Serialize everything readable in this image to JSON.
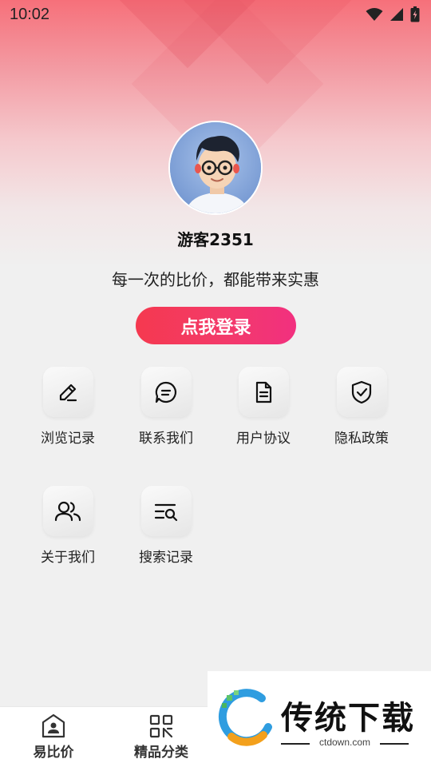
{
  "status_bar": {
    "time": "10:02"
  },
  "profile": {
    "username": "游客2351",
    "slogan": "每一次的比价，都能带来实惠",
    "login_label": "点我登录"
  },
  "menu": [
    {
      "label": "浏览记录",
      "icon": "edit-pencil-icon"
    },
    {
      "label": "联系我们",
      "icon": "chat-bubble-icon"
    },
    {
      "label": "用户协议",
      "icon": "document-icon"
    },
    {
      "label": "隐私政策",
      "icon": "shield-check-icon"
    },
    {
      "label": "关于我们",
      "icon": "users-icon"
    },
    {
      "label": "搜索记录",
      "icon": "list-search-icon"
    }
  ],
  "bottom_nav": [
    {
      "label": "易比价",
      "icon": "home-profile-icon"
    },
    {
      "label": "精品分类",
      "icon": "grid-category-icon"
    }
  ],
  "watermark": {
    "text": "传统下载",
    "url": "ctdown.com"
  },
  "colors": {
    "accent_start": "#f5394f",
    "accent_end": "#f2307f",
    "header_top": "#f6707a",
    "background": "#f0f0f0"
  }
}
